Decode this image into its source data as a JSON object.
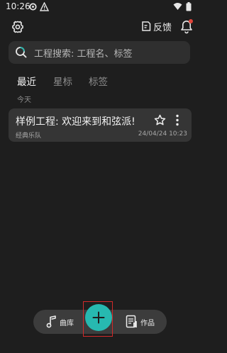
{
  "status_bar": {
    "time": "10:26",
    "icons": [
      "gear-icon",
      "alert-icon",
      "wifi-icon",
      "battery-icon"
    ]
  },
  "toolbar": {
    "settings_icon": "gear-icon",
    "feedback_label": "反馈",
    "bell_icon": "bell-icon"
  },
  "search": {
    "placeholder": "工程搜索: 工程名、标签"
  },
  "tabs": [
    {
      "label": "最近",
      "active": true
    },
    {
      "label": "星标",
      "active": false
    },
    {
      "label": "标签",
      "active": false
    }
  ],
  "section": {
    "label": "今天"
  },
  "projects": [
    {
      "title": "样例工程: 欢迎来到和弦派!",
      "subtitle": "经典乐队",
      "date": "24/04/24 10:23",
      "starred": false
    }
  ],
  "bottom_nav": {
    "library_label": "曲库",
    "works_label": "作品",
    "add_icon": "plus-icon"
  },
  "colors": {
    "background": "#1e1e1e",
    "accent": "#27b9b0",
    "card": "#353535",
    "highlight_frame": "#d22a2a"
  }
}
